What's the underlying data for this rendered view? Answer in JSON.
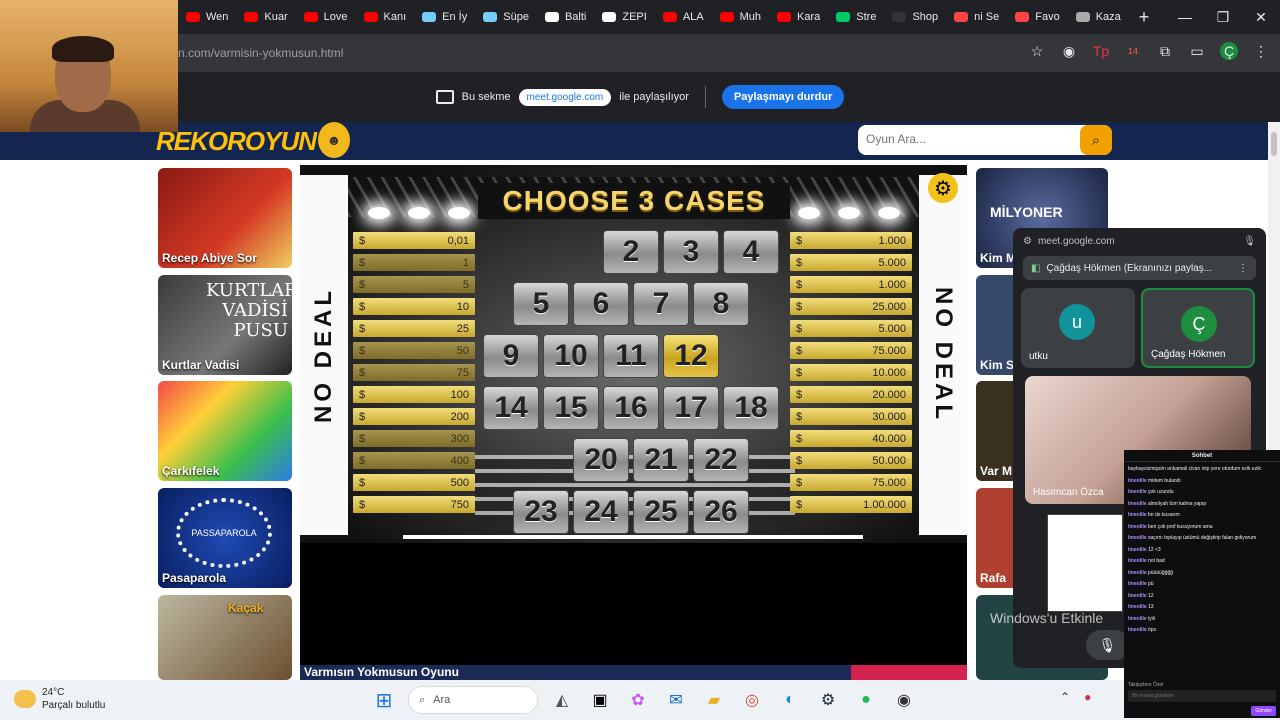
{
  "browser": {
    "tabs": [
      "Wen",
      "Kuar",
      "Love",
      "Kanı",
      "En İy",
      "Süpe",
      "Balti",
      "ZEPI",
      "ALA",
      "Muh",
      "Kara",
      "Stre",
      "Shop",
      "ni Se",
      "Favo",
      "Kaza"
    ],
    "url": "n.com/varmisin-yokmusun.html",
    "share_text_1": "Bu sekme",
    "share_chip": "meet.google.com",
    "share_text_2": "ile paylaşılıyor",
    "stop_label": "Paylaşmayı durdur",
    "profile_initial": "Ç",
    "ext_badge": "14"
  },
  "site": {
    "logo": "REKOROYUN",
    "search_placeholder": "Oyun Ara..."
  },
  "left_games": [
    "Recep Abiye Sor",
    "Kurtlar Vadisi",
    "Çarkıfelek",
    "Pasaparola",
    "Kaçak"
  ],
  "left_game_art": {
    "kurtlar": "KURTLAR VADİSİ PUSU",
    "pasaparola": "PASSAPAROLA"
  },
  "right_games": [
    "Kim M",
    "Kim S",
    "Var M",
    "Rafa",
    ""
  ],
  "right_game_art": {
    "milyoner": "MİLYONER"
  },
  "game": {
    "title": "CHOOSE 3 CASES",
    "side_text": "NO DEAL",
    "currency": "$",
    "left_amounts": [
      "0,01",
      "1",
      "5",
      "10",
      "25",
      "50",
      "75",
      "100",
      "200",
      "300",
      "400",
      "500",
      "750"
    ],
    "right_amounts": [
      "1.000",
      "5.000",
      "1.000",
      "25.000",
      "5.000",
      "75.000",
      "10.000",
      "20.000",
      "30.000",
      "40.000",
      "50.000",
      "75.000",
      "1.00.000"
    ],
    "case_rows": [
      [
        "",
        "2",
        "3",
        "4"
      ],
      [
        "5",
        "6",
        "7",
        "8"
      ],
      [
        "9",
        "10",
        "11",
        "12"
      ],
      [
        "14",
        "15",
        "16",
        "17",
        "18"
      ],
      [
        "20",
        "21",
        "22"
      ],
      [
        "23",
        "24",
        "25",
        "26"
      ]
    ],
    "selected_case": "12",
    "footer_title": "Varmısın Yokmusun Oyunu"
  },
  "meet": {
    "host": "meet.google.com",
    "share_title": "Çağdaş Hökmen (Ekranınızı paylaş...",
    "participants": [
      {
        "initial": "u",
        "name": "utku"
      },
      {
        "initial": "Ç",
        "name": "Çağdaş Hökmen"
      }
    ],
    "cam_name": "Hasimcan Özca",
    "watermark": "Windows'u Etkinle"
  },
  "chat": {
    "title": "Sohbet",
    "lines": [
      {
        "u": "",
        "t": "baybaysizmişsim ankamali civan inip yere oturdum ezik ezik"
      },
      {
        "u": "lmeolile",
        "t": "midem bulandı"
      },
      {
        "u": "lmeolile",
        "t": "çok uzundu"
      },
      {
        "u": "lmeolile",
        "t": "almolyah tüm kalma yapıp"
      },
      {
        "u": "lmeolile",
        "t": "bn de kusarım"
      },
      {
        "u": "lmeolile",
        "t": "ben çok prof kusuyorum ama"
      },
      {
        "u": "lmeolile",
        "t": "saçımı toplayıp üstümü değiştirip falan gidiyorum"
      },
      {
        "u": "lmeolile",
        "t": "12 <3"
      },
      {
        "u": "lmeolile",
        "t": "not bad"
      },
      {
        "u": "lmeolile",
        "t": "püüüüğğğğ"
      },
      {
        "u": "lmeolile",
        "t": "pü"
      },
      {
        "u": "lmeolile",
        "t": "12"
      },
      {
        "u": "lmeolile",
        "t": "13"
      },
      {
        "u": "lmeolile",
        "t": "iyiii"
      },
      {
        "u": "lmeolile",
        "t": "öps"
      }
    ],
    "footer": "Takipçilere Özel",
    "placeholder": "Bir mesaj gönderin",
    "send": "Gönder"
  },
  "taskbar": {
    "temp": "24°C",
    "weather": "Parçalı bulutlu",
    "search": "Ara"
  }
}
